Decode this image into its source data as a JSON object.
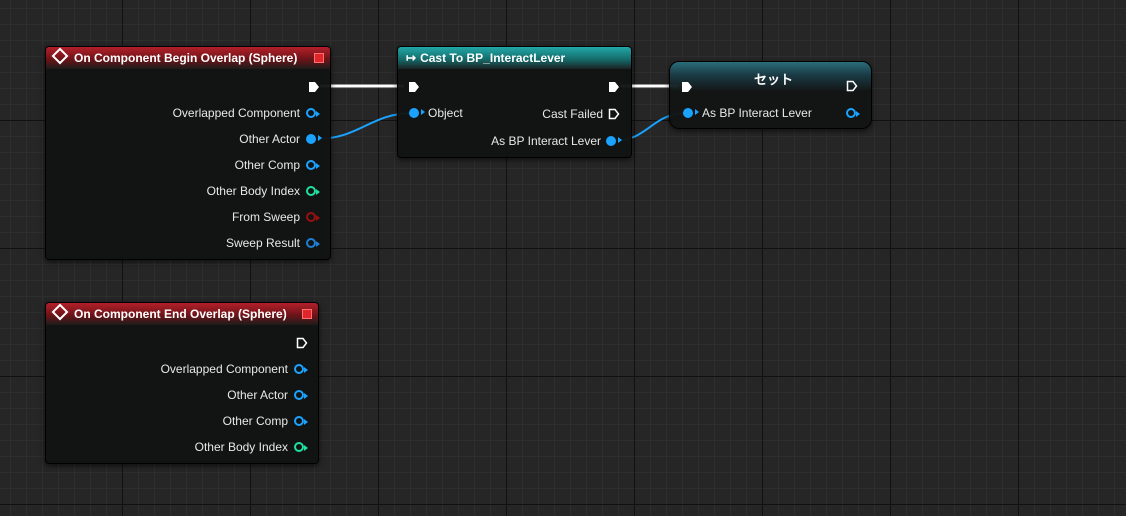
{
  "colors": {
    "object_pin": "#1aa3ff",
    "int_pin": "#1fe0a0",
    "bool_pin": "#9a1010",
    "struct_pin": "#1e7fd6",
    "exec_pin": "#ffffff",
    "event_header": "#b3202a",
    "cast_header": "#22a8a8"
  },
  "begin_overlap": {
    "title": "On Component Begin Overlap (Sphere)",
    "icon": "event-diamond-icon",
    "pins": [
      "Overlapped Component",
      "Other Actor",
      "Other Comp",
      "Other Body Index",
      "From Sweep",
      "Sweep Result"
    ]
  },
  "end_overlap": {
    "title": "On Component End Overlap (Sphere)",
    "icon": "event-diamond-icon",
    "pins": [
      "Overlapped Component",
      "Other Actor",
      "Other Comp",
      "Other Body Index"
    ]
  },
  "cast_node": {
    "title": "Cast To BP_InteractLever",
    "icon": "cast-arrow-icon",
    "input_object": "Object",
    "cast_failed": "Cast Failed",
    "output": "As BP Interact Lever"
  },
  "set_node": {
    "title": "セット",
    "input": "As BP Interact Lever"
  }
}
